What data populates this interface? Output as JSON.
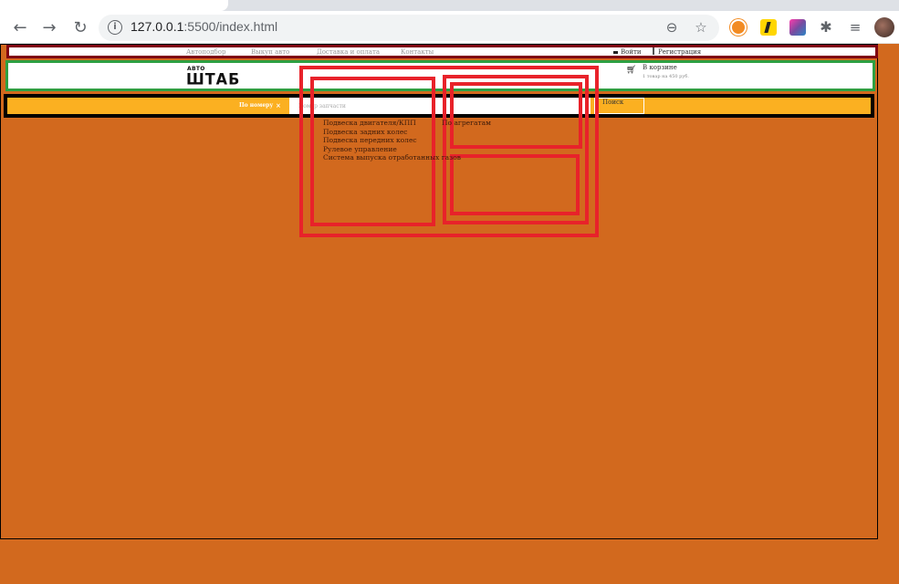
{
  "browser": {
    "url_host": "127.0.0.1",
    "url_rest": ":5500/index.html"
  },
  "topbar": {
    "links": [
      "Автоподбор",
      "Выкуп авто",
      "Доставка и оплата",
      "Контакты"
    ],
    "login_label": "Войти",
    "register_label": "Регистрация"
  },
  "header": {
    "logo_small": "АВТО",
    "logo_big": "ШТАБ",
    "cart_title": "В корзине",
    "cart_info": "1 товар на 450 руб."
  },
  "search": {
    "mode_label": "По номеру",
    "mode_close": "×",
    "placeholder": "Номер запчасти",
    "button_label": "Поиск"
  },
  "dropdown": {
    "items": [
      "Подвеска двигателя/КПП",
      "Подвеска задних колес",
      "Подвеска передних колес",
      "Рулевое управление",
      "Система выпуска отработанных газов"
    ],
    "right_label": "По агрегатам"
  },
  "colors": {
    "page_bg": "#D2691E",
    "topbar_border": "#800010",
    "header_border": "#2EA043",
    "searchbar_bg": "#FBB021",
    "dropdown_border": "#E8222A"
  }
}
